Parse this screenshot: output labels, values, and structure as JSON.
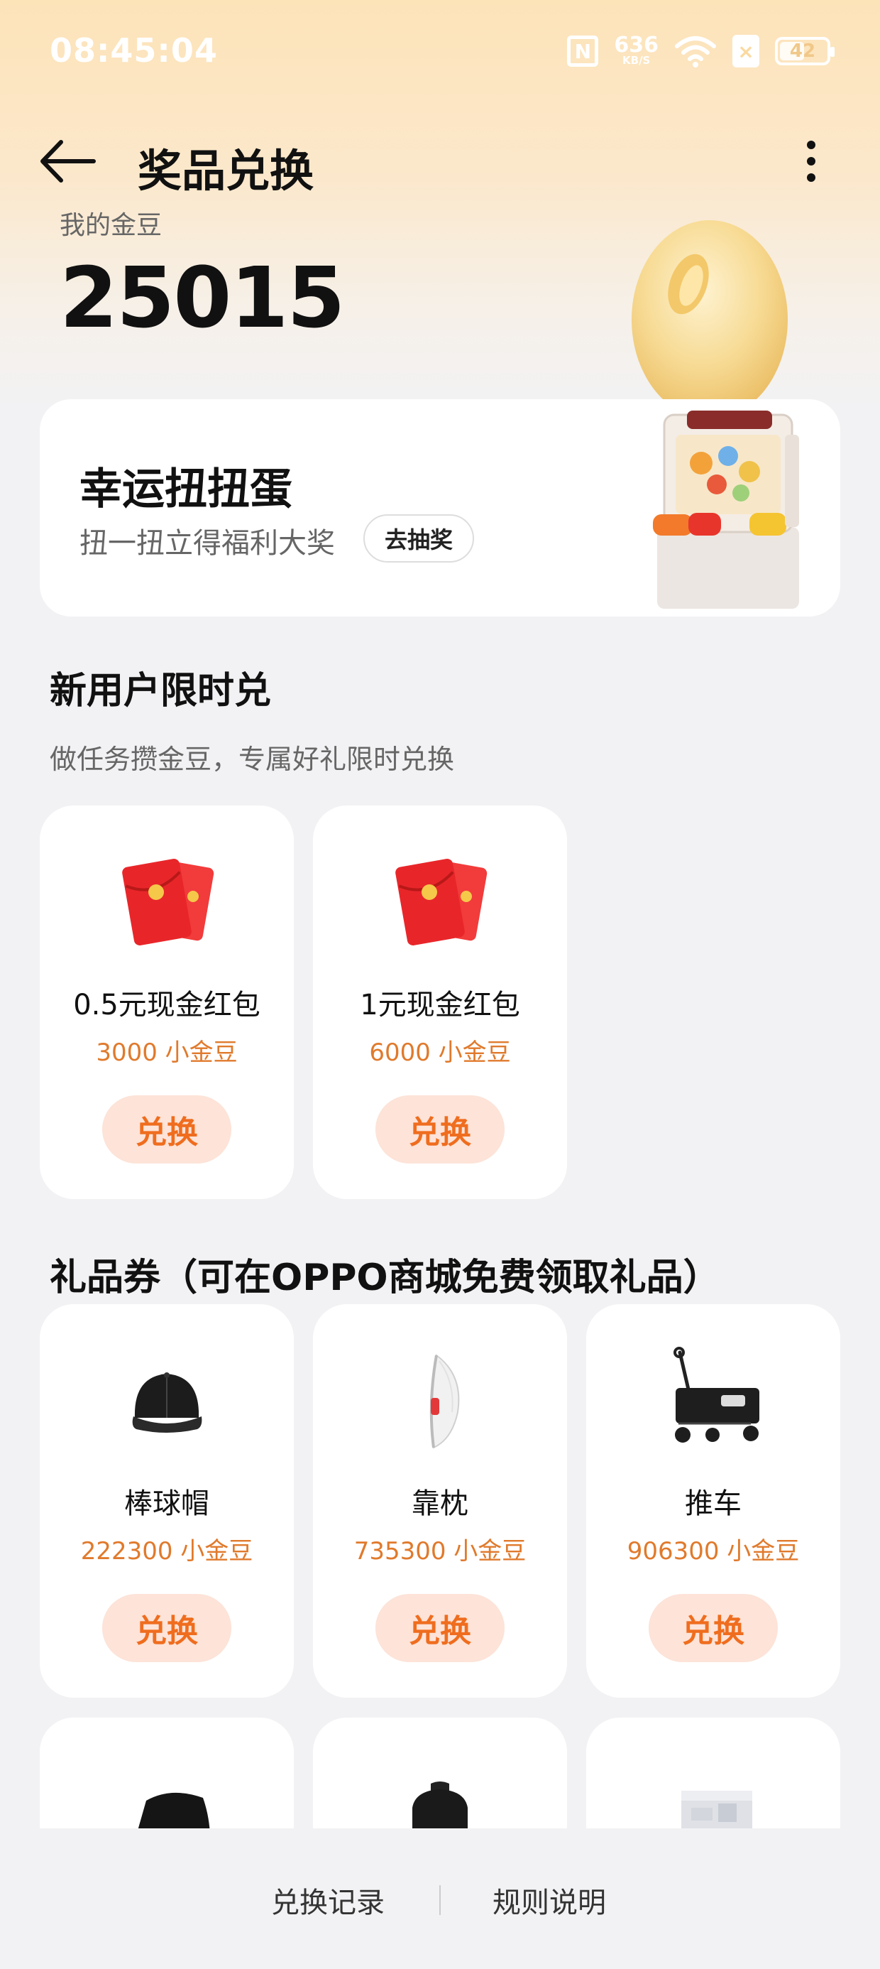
{
  "status_bar": {
    "time": "08:45:04",
    "net_speed": "636",
    "net_speed_unit": "KB/S",
    "battery": "42"
  },
  "nav": {
    "title": "奖品兑换"
  },
  "beans": {
    "label": "我的金豆",
    "value": "25015"
  },
  "lucky": {
    "title": "幸运扭扭蛋",
    "subtitle": "扭一扭立得福利大奖",
    "button": "去抽奖"
  },
  "new_user": {
    "title": "新用户限时兑",
    "subtitle": "做任务攒金豆，专属好礼限时兑换",
    "items": [
      {
        "name": "0.5元现金红包",
        "price": "3000 小金豆",
        "button": "兑换",
        "icon": "red-envelope-icon"
      },
      {
        "name": "1元现金红包",
        "price": "6000 小金豆",
        "button": "兑换",
        "icon": "red-envelope-icon"
      }
    ]
  },
  "gifts": {
    "title": "礼品券（可在OPPO商城免费领取礼品）",
    "items": [
      {
        "name": "棒球帽",
        "price": "222300 小金豆",
        "button": "兑换",
        "icon": "baseball-cap-icon"
      },
      {
        "name": "靠枕",
        "price": "735300 小金豆",
        "button": "兑换",
        "icon": "pillow-icon"
      },
      {
        "name": "推车",
        "price": "906300 小金豆",
        "button": "兑换",
        "icon": "wagon-cart-icon"
      }
    ],
    "partial_items": [
      {
        "icon": "umbrella-icon"
      },
      {
        "icon": "backpack-icon"
      },
      {
        "icon": "gift-box-icon"
      }
    ]
  },
  "bottom": {
    "history": "兑换记录",
    "rules": "规则说明"
  },
  "colors": {
    "accent": "#ef6d1e",
    "price": "#e07a2c",
    "button_bg": "#fde3d8",
    "header_gradient_top": "#fde3b8"
  }
}
